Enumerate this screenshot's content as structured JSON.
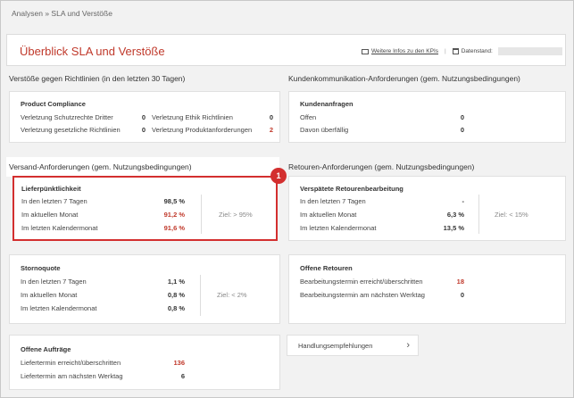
{
  "breadcrumb": "Analysen » SLA und Verstöße",
  "header": {
    "title": "Überblick SLA und Verstöße",
    "link": "Weitere Infos zu den KPIs",
    "date_label": "Datenstand:"
  },
  "sections": {
    "violations": "Verstöße gegen Richtlinien (in den letzten 30 Tagen)",
    "customer": "Kundenkommunikation-Anforderungen (gem. Nutzungsbedingungen)",
    "shipping": "Versand-Anforderungen (gem. Nutzungsbedingungen)",
    "returns": "Retouren-Anforderungen (gem. Nutzungsbedingungen)"
  },
  "compliance": {
    "title": "Product Compliance",
    "r1l": "Verletzung Schutzrechte Dritter",
    "r1lv": "0",
    "r1r": "Verletzung Ethik Richtlinien",
    "r1rv": "0",
    "r2l": "Verletzung gesetzliche Richtlinien",
    "r2lv": "0",
    "r2r": "Verletzung Produktanforderungen",
    "r2rv": "2"
  },
  "customer_requests": {
    "title": "Kundenanfragen",
    "r1": "Offen",
    "r1v": "0",
    "r2": "Davon überfällig",
    "r2v": "0"
  },
  "delivery": {
    "title": "Lieferpünktlichkeit",
    "r1": "In den letzten 7 Tagen",
    "r1v": "98,5 %",
    "r2": "Im aktuellen Monat",
    "r2v": "91,2 %",
    "r3": "Im letzten Kalendermonat",
    "r3v": "91,6 %",
    "target": "Ziel: > 95%"
  },
  "late_returns": {
    "title": "Verspätete Retourenbearbeitung",
    "r1": "In den letzten 7 Tagen",
    "r1v": "-",
    "r2": "Im aktuellen Monat",
    "r2v": "6,3 %",
    "r3": "Im letzten Kalendermonat",
    "r3v": "13,5 %",
    "target": "Ziel: < 15%"
  },
  "cancel": {
    "title": "Stornoquote",
    "r1": "In den letzten 7 Tagen",
    "r1v": "1,1 %",
    "r2": "Im aktuellen Monat",
    "r2v": "0,8 %",
    "r3": "Im letzten Kalendermonat",
    "r3v": "0,8 %",
    "target": "Ziel: < 2%"
  },
  "open_returns": {
    "title": "Offene Retouren",
    "r1": "Bearbeitungstermin erreicht/überschritten",
    "r1v": "18",
    "r2": "Bearbeitungstermin am nächsten Werktag",
    "r2v": "0"
  },
  "open_orders": {
    "title": "Offene Aufträge",
    "r1": "Liefertermin erreicht/überschritten",
    "r1v": "136",
    "r2": "Liefertermin am nächsten Werktag",
    "r2v": "6"
  },
  "actions": {
    "label": "Handlungsempfehlungen",
    "chevron": "›"
  },
  "badge": "1",
  "colors": {
    "accent": "#c0392b",
    "highlight": "#d32f2f"
  }
}
